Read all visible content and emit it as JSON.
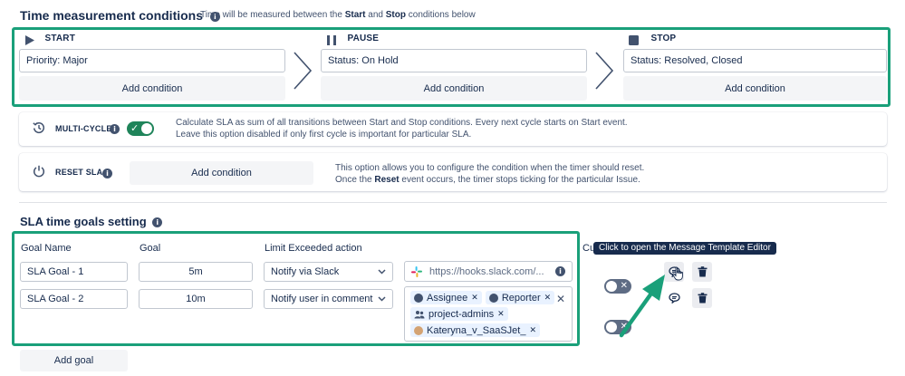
{
  "time_conditions": {
    "title": "Time measurement conditions",
    "hint_prefix": "Time will be measured between the ",
    "hint_start": "Start",
    "hint_mid": " and ",
    "hint_stop": "Stop",
    "hint_suffix": " conditions below",
    "columns": {
      "start": {
        "label": "START",
        "condition": "Priority: Major",
        "add_label": "Add condition"
      },
      "pause": {
        "label": "PAUSE",
        "condition": "Status: On Hold",
        "add_label": "Add condition"
      },
      "stop": {
        "label": "STOP",
        "condition": "Status: Resolved, Closed",
        "add_label": "Add condition"
      }
    }
  },
  "multi_cycle": {
    "label": "MULTI-CYCLE",
    "enabled": true,
    "desc_line1": "Calculate SLA as sum of all transitions between Start and Stop conditions. Every next cycle starts on Start event.",
    "desc_line2": "Leave this option disabled if only first cycle is important for particular SLA."
  },
  "reset_sla": {
    "label": "RESET SLA",
    "add_label": "Add condition",
    "desc_line1": "This option allows you to configure the condition when the timer should reset.",
    "desc_line2_prefix": "Once the ",
    "desc_line2_bold": "Reset",
    "desc_line2_suffix": " event occurs, the timer stops ticking for the particular Issue."
  },
  "goals": {
    "title": "SLA time goals setting",
    "headers": {
      "name": "Goal Name",
      "goal": "Goal",
      "action": "Limit Exceeded action",
      "cut": "Cu"
    },
    "rows": [
      {
        "name": "SLA Goal - 1",
        "goal": "5m",
        "action": "Notify via Slack",
        "target": "https://hooks.slack.com/..."
      },
      {
        "name": "SLA Goal - 2",
        "goal": "10m",
        "action": "Notify user in comment",
        "chips": [
          "Assignee",
          "Reporter",
          "project-admins",
          "Kateryna_v_SaaSJet_"
        ]
      }
    ],
    "add_goal_label": "Add goal",
    "tooltip": "Click to open the Message Template Editor"
  },
  "colors": {
    "accent_green": "#1aa07a",
    "toggle_on": "#1f845a",
    "chip_bg": "#e9f2ff"
  }
}
